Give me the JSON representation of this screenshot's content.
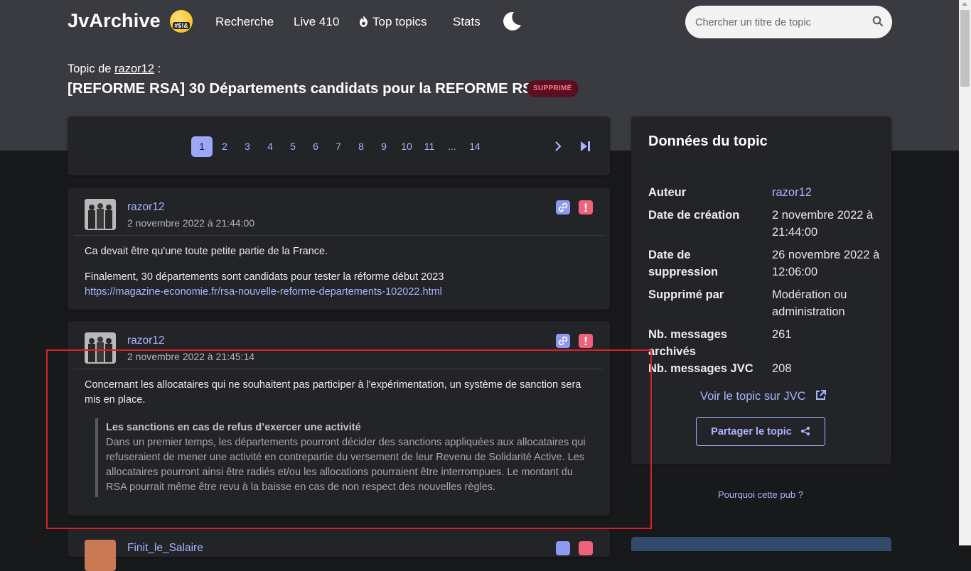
{
  "nav": {
    "logo": "JvArchive",
    "logo_badge": "#$!&",
    "items": [
      "Recherche",
      "Live 410",
      "Top topics",
      "Stats"
    ],
    "search_placeholder": "Chercher un titre de topic"
  },
  "topic": {
    "by_prefix": "Topic de",
    "author": "razor12",
    "by_suffix": ":",
    "title": "[REFORME RSA] 30 Départements candidats pour la REFORME RSA",
    "badge": "SUPPRIMÉ"
  },
  "pagination": {
    "pages": [
      "1",
      "2",
      "3",
      "4",
      "5",
      "6",
      "7",
      "8",
      "9",
      "10",
      "11",
      "...",
      "14"
    ],
    "current": "1"
  },
  "messages": [
    {
      "author": "razor12",
      "date": "2 novembre 2022 à 21:44:00",
      "p1": "Ca devait être qu'une toute petite partie de la France.",
      "p2": "Finalement, 30 départements sont candidats pour tester la réforme début 2023",
      "link": "https://magazine-economie.fr/rsa-nouvelle-reforme-departements-102022.html"
    },
    {
      "author": "razor12",
      "date": "2 novembre 2022 à 21:45:14",
      "p1": "Concernant les allocataires qui ne souhaitent pas participer à l'expérimentation, un système de sanction sera mis en place.",
      "quote_title": "Les sanctions en cas de refus d’exercer une activité",
      "quote_text": "Dans un premier temps, les départements pourront décider des sanctions appliquées aux allocataires qui refuseraient de mener une activité en contrepartie du versement de leur Revenu de Solidarité Active. Les allocataires pourront ainsi être radiés et/ou les allocations pourraient être interrompues. Le montant du RSA pourrait même être revu à la baisse en cas de non respect des nouvelles règles."
    },
    {
      "author": "Finit_le_Salaire"
    }
  ],
  "sidebar": {
    "title": "Données du topic",
    "rows": [
      {
        "k": "Auteur",
        "v": "razor12"
      },
      {
        "k": "Date de création",
        "v": "2 novembre 2022 à 21:44:00"
      },
      {
        "k": "Date de suppression",
        "v": "26 novembre 2022 à 12:06:00"
      },
      {
        "k": "Supprimé par",
        "v": "Modération ou administration"
      },
      {
        "k": "Nb. messages archivés",
        "v": "261"
      },
      {
        "k": "Nb. messages JVC",
        "v": "208"
      }
    ],
    "voir": "Voir le topic sur JVC",
    "share": "Partager le topic",
    "pub": "Pourquoi cette pub ?"
  },
  "colors": {
    "accent": "#a9b4ff",
    "badge_bg": "#5a1020",
    "badge_text": "#ff7a8e",
    "highlight_box": "#d8202a"
  }
}
